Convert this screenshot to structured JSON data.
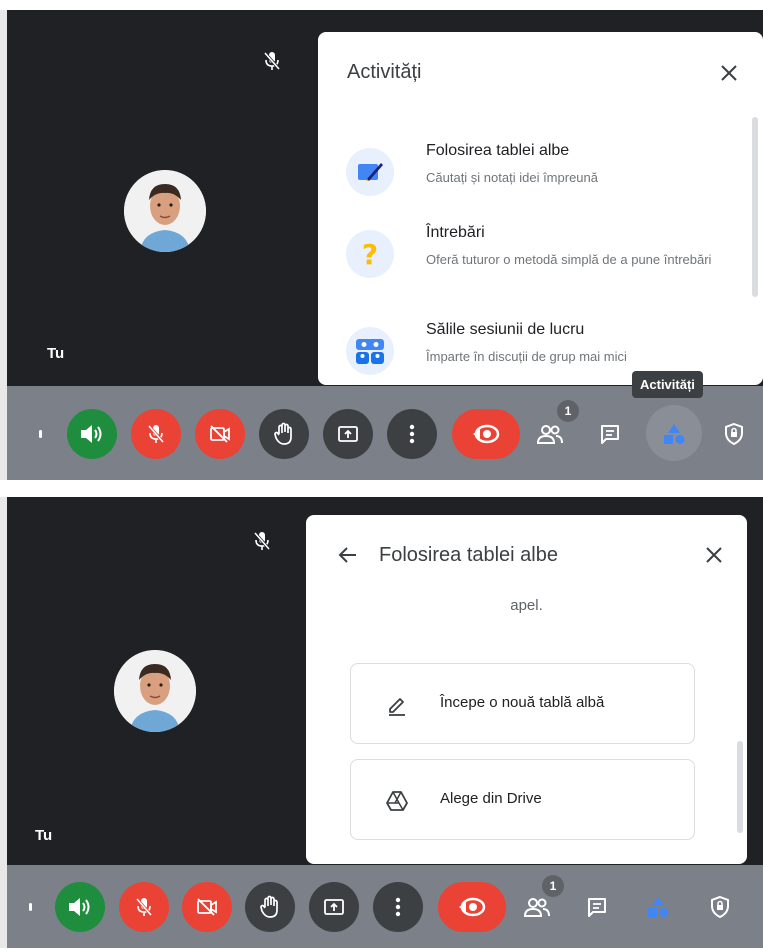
{
  "top": {
    "participant_name": "Tu",
    "panel": {
      "title": "Activități",
      "items": [
        {
          "title": "Folosirea tablei albe",
          "desc": "Căutați și notați idei împreună",
          "icon": "whiteboard-icon"
        },
        {
          "title": "Întrebări",
          "desc": "Oferă tuturor o metodă simplă de a pune întrebări",
          "icon": "question-icon"
        },
        {
          "title": "Sălile sesiunii de lucru",
          "desc": "Împarte în discuții de grup mai mici",
          "icon": "breakout-rooms-icon"
        }
      ]
    },
    "tooltip": "Activități",
    "participants_count": "1"
  },
  "bottom": {
    "participant_name": "Tu",
    "panel": {
      "title": "Folosirea tablei albe",
      "partial_text": "apel.",
      "options": [
        {
          "label": "Începe o nouă tablă albă",
          "icon": "pencil-icon"
        },
        {
          "label": "Alege din Drive",
          "icon": "drive-icon"
        }
      ]
    },
    "participants_count": "1"
  },
  "colors": {
    "toolbar_bg": "#7b8089",
    "video_bg": "#202124",
    "green": "#1e8e3e",
    "red": "#ea4335",
    "dark_btn": "#3c4043"
  }
}
